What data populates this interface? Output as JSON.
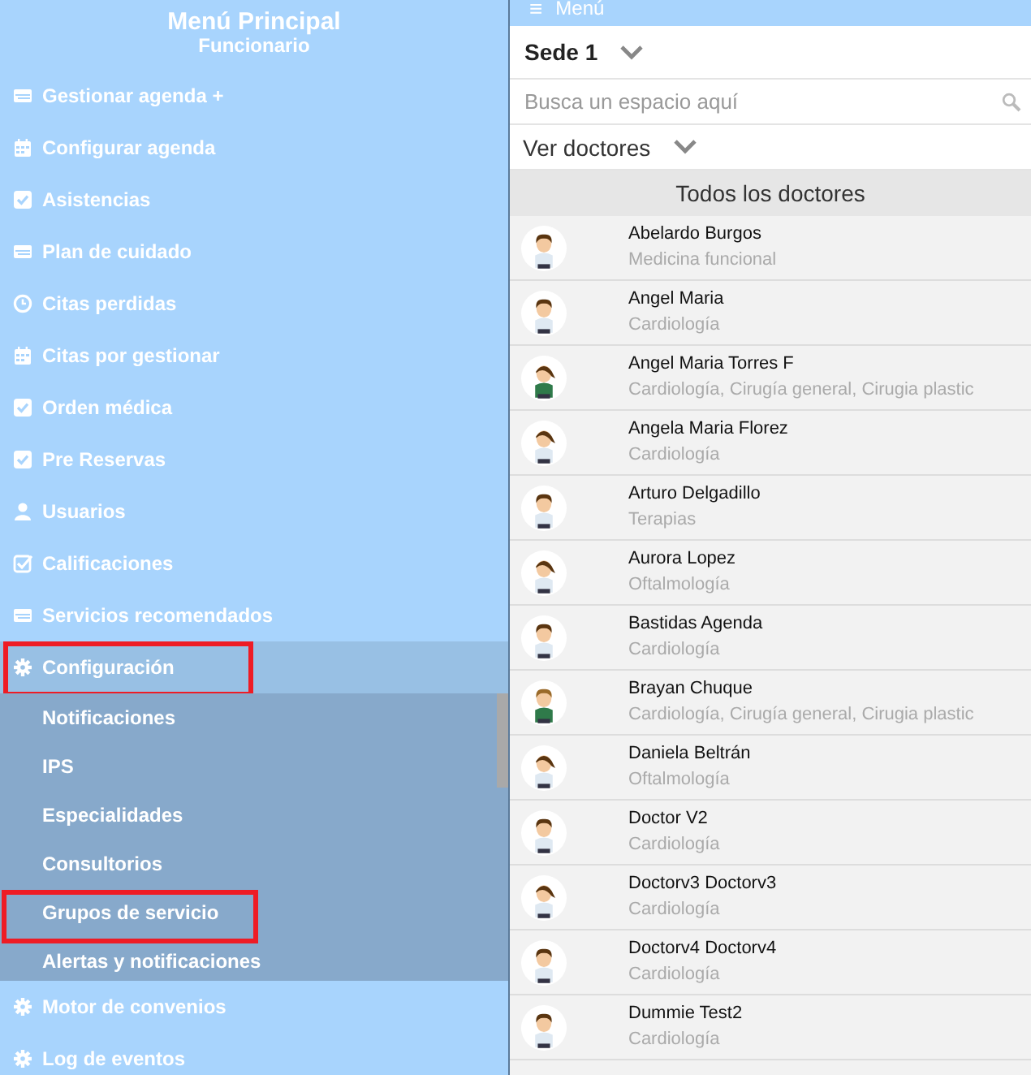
{
  "sidebar": {
    "title": "Menú Principal",
    "subtitle": "Funcionario",
    "items": [
      {
        "label": "Gestionar agenda +",
        "kind": "card",
        "expanded": false,
        "highlighted": false
      },
      {
        "label": "Configurar agenda",
        "kind": "calendar",
        "expanded": false,
        "highlighted": false
      },
      {
        "label": "Asistencias",
        "kind": "check",
        "expanded": false,
        "highlighted": false
      },
      {
        "label": "Plan de cuidado",
        "kind": "card",
        "expanded": false,
        "highlighted": false
      },
      {
        "label": "Citas perdidas",
        "kind": "clock",
        "expanded": false,
        "highlighted": false
      },
      {
        "label": "Citas por gestionar",
        "kind": "calendar",
        "expanded": false,
        "highlighted": false
      },
      {
        "label": "Orden médica",
        "kind": "check",
        "expanded": false,
        "highlighted": false
      },
      {
        "label": "Pre Reservas",
        "kind": "check",
        "expanded": false,
        "highlighted": false
      },
      {
        "label": "Usuarios",
        "kind": "user",
        "expanded": false,
        "highlighted": false
      },
      {
        "label": "Calificaciones",
        "kind": "checkout",
        "expanded": false,
        "highlighted": false
      },
      {
        "label": "Servicios recomendados",
        "kind": "card",
        "expanded": false,
        "highlighted": false
      },
      {
        "label": "Configuración",
        "kind": "gear",
        "expanded": true,
        "highlighted": true,
        "children": [
          {
            "label": "Notificaciones",
            "highlighted": false
          },
          {
            "label": "IPS",
            "highlighted": false
          },
          {
            "label": "Especialidades",
            "highlighted": false
          },
          {
            "label": "Consultorios",
            "highlighted": false
          },
          {
            "label": "Grupos de servicio",
            "highlighted": true
          },
          {
            "label": "Alertas y notificaciones",
            "highlighted": false
          }
        ]
      },
      {
        "label": "Motor de convenios",
        "kind": "gear",
        "expanded": false,
        "highlighted": false
      },
      {
        "label": "Log de eventos",
        "kind": "gear",
        "expanded": false,
        "highlighted": false
      }
    ]
  },
  "topbar": {
    "icon": "≡",
    "label": "Menú"
  },
  "site_select": {
    "value": "Sede 1"
  },
  "search": {
    "placeholder": "Busca un espacio aquí"
  },
  "view_select": {
    "value": "Ver doctores"
  },
  "list": {
    "heading": "Todos los doctores",
    "doctors": [
      {
        "name": "Abelardo Burgos",
        "specialty": "Medicina funcional",
        "kind": "man"
      },
      {
        "name": "Angel Maria",
        "specialty": "Cardiología",
        "kind": "man"
      },
      {
        "name": "Angel Maria Torres F",
        "specialty": "Cardiología, Cirugía general, Cirugia plastic",
        "kind": "woman-scarf"
      },
      {
        "name": "Angela Maria Florez",
        "specialty": "Cardiología",
        "kind": "woman"
      },
      {
        "name": "Arturo Delgadillo",
        "specialty": "Terapias",
        "kind": "man"
      },
      {
        "name": "Aurora Lopez",
        "specialty": "Oftalmología",
        "kind": "woman"
      },
      {
        "name": "Bastidas Agenda",
        "specialty": "Cardiología",
        "kind": "man"
      },
      {
        "name": "Brayan Chuque",
        "specialty": "Cardiología, Cirugía general, Cirugia plastic",
        "kind": "man-scarf"
      },
      {
        "name": "Daniela Beltrán",
        "specialty": "Oftalmología",
        "kind": "woman"
      },
      {
        "name": "Doctor V2",
        "specialty": "Cardiología",
        "kind": "man"
      },
      {
        "name": "Doctorv3 Doctorv3",
        "specialty": "Cardiología",
        "kind": "woman"
      },
      {
        "name": "Doctorv4 Doctorv4",
        "specialty": "Cardiología",
        "kind": "man"
      },
      {
        "name": "Dummie Test2",
        "specialty": "Cardiología",
        "kind": "man"
      }
    ]
  }
}
